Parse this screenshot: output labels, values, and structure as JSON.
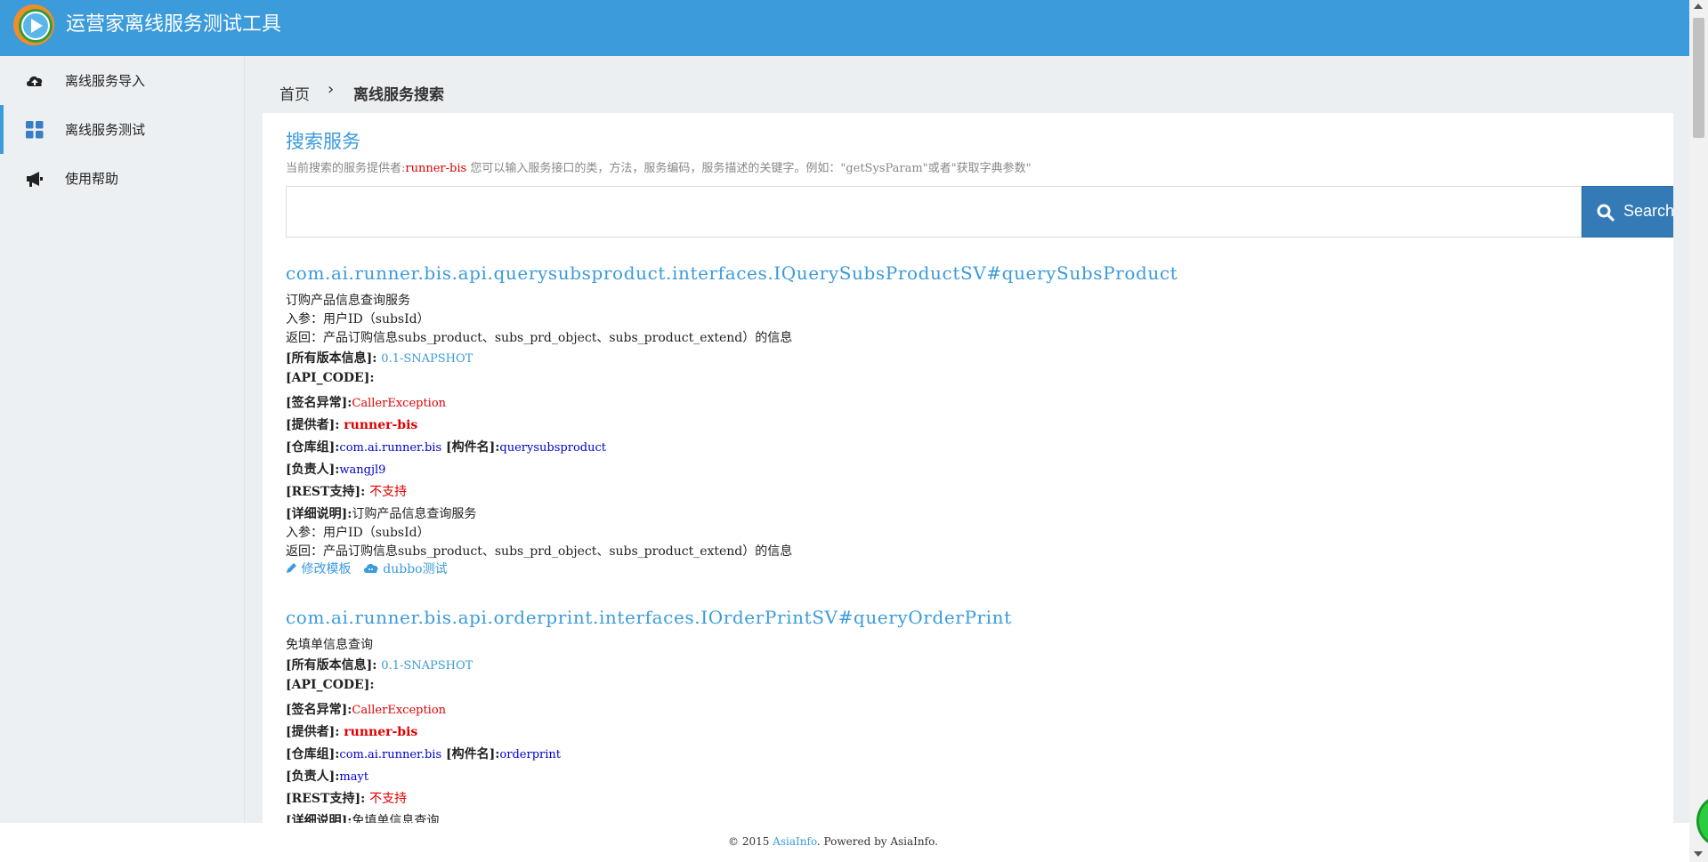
{
  "header": {
    "title": "运营家离线服务测试工具",
    "logo_icon": "play-logo-icon"
  },
  "sidebar": {
    "items": [
      {
        "label": "离线服务导入",
        "icon": "cloud-upload-icon",
        "active": false
      },
      {
        "label": "离线服务测试",
        "icon": "grid-icon",
        "active": true
      },
      {
        "label": "使用帮助",
        "icon": "megaphone-icon",
        "active": false
      }
    ]
  },
  "breadcrumb": {
    "home": "首页",
    "separator": "›",
    "current": "离线服务搜索"
  },
  "search": {
    "title": "搜索服务",
    "hint_prefix": "当前搜索的服务提供者:",
    "provider": "runner-bis",
    "hint_suffix": " 您可以输入服务接口的类，方法，服务编码，服务描述的关键字。例如：\"getSysParam\"或者\"获取字典参数\"",
    "input_value": "",
    "input_placeholder": "",
    "button_label": "Search"
  },
  "results": [
    {
      "name": "com.ai.runner.bis.api.querysubsproduct.interfaces.IQuerySubsProductSV#querySubsProduct",
      "description": "订购产品信息查询服务",
      "params": "入参：用户ID（subsId）",
      "returns": "返回：产品订购信息subs_product、subs_prd_object、subs_product_extend）的信息",
      "versions_label": "[所有版本信息]: ",
      "versions_value": "0.1-SNAPSHOT",
      "api_code_label": "[API_CODE]:",
      "exception_label": "[签名异常]:",
      "exception_value": "CallerException",
      "provider_label": "[提供者]: ",
      "provider_value": "runner-bis",
      "group_label": "[仓库组]:",
      "group_value": "com.ai.runner.bis",
      "artifact_label": " [构件名]:",
      "artifact_value": "querysubsproduct",
      "owner_label": "[负责人]:",
      "owner_value": "wangjl9",
      "rest_label": "[REST支持]: ",
      "rest_value": "不支持",
      "detail_label": "[详细说明]:",
      "detail_value": "订购产品信息查询服务",
      "detail_params": "入参：用户ID（subsId）",
      "detail_returns": "返回：产品订购信息subs_product、subs_prd_object、subs_product_extend）的信息",
      "edit_label": "修改模板",
      "test_label": "dubbo测试"
    },
    {
      "name": "com.ai.runner.bis.api.orderprint.interfaces.IOrderPrintSV#queryOrderPrint",
      "description": "免填单信息查询",
      "versions_label": "[所有版本信息]: ",
      "versions_value": "0.1-SNAPSHOT",
      "api_code_label": "[API_CODE]:",
      "exception_label": "[签名异常]:",
      "exception_value": "CallerException",
      "provider_label": "[提供者]: ",
      "provider_value": "runner-bis",
      "group_label": "[仓库组]:",
      "group_value": "com.ai.runner.bis",
      "artifact_label": " [构件名]:",
      "artifact_value": "orderprint",
      "owner_label": "[负责人]:",
      "owner_value": "mayt",
      "rest_label": "[REST支持]: ",
      "rest_value": "不支持",
      "detail_label": "[详细说明]:",
      "detail_value": "免填单信息查询"
    }
  ],
  "footer": {
    "prefix": "© 2015 ",
    "brand": "AsiaInfo",
    "suffix": ". Powered by AsiaInfo."
  },
  "colors": {
    "header_bg": "#3b9bdb",
    "accent": "#3b9bdb",
    "button_bg": "#337ab7",
    "error_red": "#e00000",
    "link_navy": "#0000cc"
  }
}
